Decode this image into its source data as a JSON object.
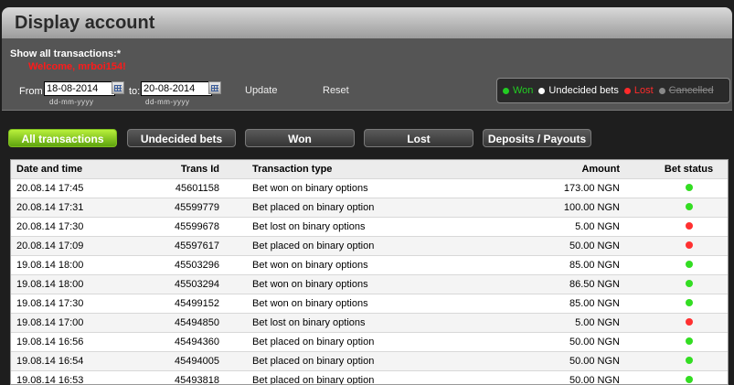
{
  "header": {
    "title": "Display account"
  },
  "filters": {
    "show_all_label": "Show all transactions:*",
    "welcome_text": "Welcome, mrboi154!",
    "from_label": "From",
    "from_value": "18-08-2014",
    "to_label": "to:",
    "to_value": "20-08-2014",
    "date_format_hint": "dd-mm-yyyy",
    "update_label": "Update",
    "reset_label": "Reset"
  },
  "legend": {
    "items": [
      {
        "label": "Won",
        "color": "#22cc22"
      },
      {
        "label": "Undecided bets",
        "color": "#ffffff"
      },
      {
        "label": "Lost",
        "color": "#ff2a2a"
      },
      {
        "label": "Cancelled",
        "color": "#888888"
      }
    ]
  },
  "tabs": [
    {
      "label": "All transactions",
      "active": true
    },
    {
      "label": "Undecided bets",
      "active": false
    },
    {
      "label": "Won",
      "active": false
    },
    {
      "label": "Lost",
      "active": false
    },
    {
      "label": "Deposits / Payouts",
      "active": false
    }
  ],
  "table": {
    "headers": [
      "Date and time",
      "Trans Id",
      "Transaction type",
      "Amount",
      "Bet status"
    ],
    "rows": [
      {
        "date": "20.08.14 17:45",
        "id": "45601158",
        "type": "Bet won on binary options",
        "amount": "173.00 NGN",
        "status": "won"
      },
      {
        "date": "20.08.14 17:31",
        "id": "45599779",
        "type": "Bet placed on binary option",
        "amount": "100.00 NGN",
        "status": "won"
      },
      {
        "date": "20.08.14 17:30",
        "id": "45599678",
        "type": "Bet lost on binary options",
        "amount": "5.00 NGN",
        "status": "lost"
      },
      {
        "date": "20.08.14 17:09",
        "id": "45597617",
        "type": "Bet placed on binary option",
        "amount": "50.00 NGN",
        "status": "lost"
      },
      {
        "date": "19.08.14 18:00",
        "id": "45503296",
        "type": "Bet won on binary options",
        "amount": "85.00 NGN",
        "status": "won"
      },
      {
        "date": "19.08.14 18:00",
        "id": "45503294",
        "type": "Bet won on binary options",
        "amount": "86.50 NGN",
        "status": "won"
      },
      {
        "date": "19.08.14 17:30",
        "id": "45499152",
        "type": "Bet won on binary options",
        "amount": "85.00 NGN",
        "status": "won"
      },
      {
        "date": "19.08.14 17:00",
        "id": "45494850",
        "type": "Bet lost on binary options",
        "amount": "5.00 NGN",
        "status": "lost"
      },
      {
        "date": "19.08.14 16:56",
        "id": "45494360",
        "type": "Bet placed on binary option",
        "amount": "50.00 NGN",
        "status": "won"
      },
      {
        "date": "19.08.14 16:54",
        "id": "45494005",
        "type": "Bet placed on binary option",
        "amount": "50.00 NGN",
        "status": "won"
      },
      {
        "date": "19.08.14 16:53",
        "id": "45493818",
        "type": "Bet placed on binary option",
        "amount": "50.00 NGN",
        "status": "won"
      }
    ],
    "status_colors": {
      "won": "#33dd22",
      "lost": "#ff3030"
    }
  }
}
